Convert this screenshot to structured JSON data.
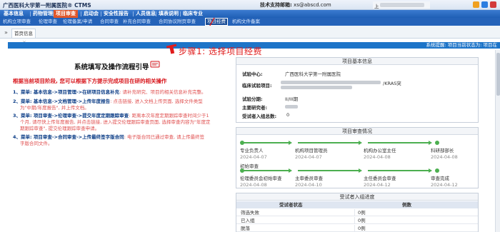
{
  "app": {
    "title": "广西医科大学第一附属医院® CTMS",
    "support_label": "技术支持邮箱:",
    "support_email": "xs@abscd.com",
    "user_prefix": "上"
  },
  "nav": {
    "items": [
      "基本信息",
      "药物管理",
      "项目审查",
      "启动会",
      "安全性报告",
      "人员信息",
      "填表说明",
      "临床专业"
    ],
    "active_index": 2
  },
  "subnav": {
    "items": [
      "机构立项审查",
      "伦理审查",
      "伦理备案/申请",
      "合同审查",
      "补充合同审查",
      "合同协议附页审查",
      "项目经费",
      "机构文件备案"
    ],
    "active_index": 6
  },
  "tabs": {
    "home_label": "首页信息",
    "close_glyph": "×"
  },
  "notice": {
    "text": "系统提醒: 项目当前状态为: 项目在"
  },
  "annotation": {
    "step1": "步骤1: 选择项目经费"
  },
  "guide": {
    "heading": "系统填写及操作流程引导",
    "intro": "根据当前项目阶段, 您可以根据下方提示完成项目在研的相关操作",
    "steps": [
      {
        "line1": "1、菜单: 基本信息->项目管理->在研项目信息补充",
        "line1_tail": ": 请补充研究、项目的相关信息补充完整。"
      },
      {
        "line1": "2、菜单: 基本信息->文档管理->上传年度报告",
        "line1_tail": ": 点击链接, 进入文档上传页面, 选择文件类型",
        "line2": "为\"中期/年度报告\", 并上传文档。"
      },
      {
        "line1": "3、菜单: 项目审查->伦理审查->提交年度定期跟踪审查",
        "line1_tail": ": 距离本次年度定期跟踪审查时间少于1",
        "line2": "个月, 请尽快上传年度报告, 并点击链接, 进入提交伦理跟踪审查页面, 选择审查内容为\"年度定",
        "line3": "期跟踪审查\", 提交伦理跟踪审查申请。"
      },
      {
        "line1": "4、菜单: 项目审查->合同审查->上传最终签字版合同",
        "line1_tail": ": 电子版合同已通过审查, 请上传最终签",
        "line2": "字版合同文件。"
      }
    ]
  },
  "basic_info": {
    "title": "项目基本信息",
    "rows": [
      {
        "label": "试验中心:",
        "value": "广西医科大学第一附属医院"
      },
      {
        "label": "临床试验项目:",
        "value": "/KRAS突"
      },
      {
        "label": "试验分期:",
        "value": "II/III期"
      },
      {
        "label": "主要研究者:",
        "value": ""
      },
      {
        "label": "受试者入组总数:",
        "value": "0"
      }
    ]
  },
  "progress": {
    "title": "项目审查情况",
    "row1": [
      {
        "name": "专业负责人",
        "date": "2024-04-07"
      },
      {
        "name": "机构项目管理员",
        "date": "2024-04-07"
      },
      {
        "name": "机构办公室主任",
        "date": "2024-04-08"
      },
      {
        "name": "科研部部长",
        "date": "2024-04-08"
      }
    ],
    "row2_label": "初始审查",
    "row2": [
      {
        "name": "伦理委员会初始审查",
        "date": "2024-04-08"
      },
      {
        "name": "主审委员审查",
        "date": "2024-04-10"
      },
      {
        "name": "主任委员会审查",
        "date": "2024-04-12"
      },
      {
        "name": "审查完成",
        "date": "2024-04-12"
      }
    ]
  },
  "enrollment": {
    "title": "受试者入组进度",
    "columns": [
      "受试者状态",
      "例数"
    ],
    "rows": [
      {
        "status": "筛选失败",
        "count": "0例"
      },
      {
        "status": "已入组",
        "count": "0例"
      },
      {
        "status": "脱落",
        "count": "0例"
      }
    ]
  },
  "colors": {
    "nav_blue": "#1f5fb5",
    "active_orange": "#e0572b",
    "alert_red": "#d8151b",
    "success_green": "#4caf50"
  }
}
